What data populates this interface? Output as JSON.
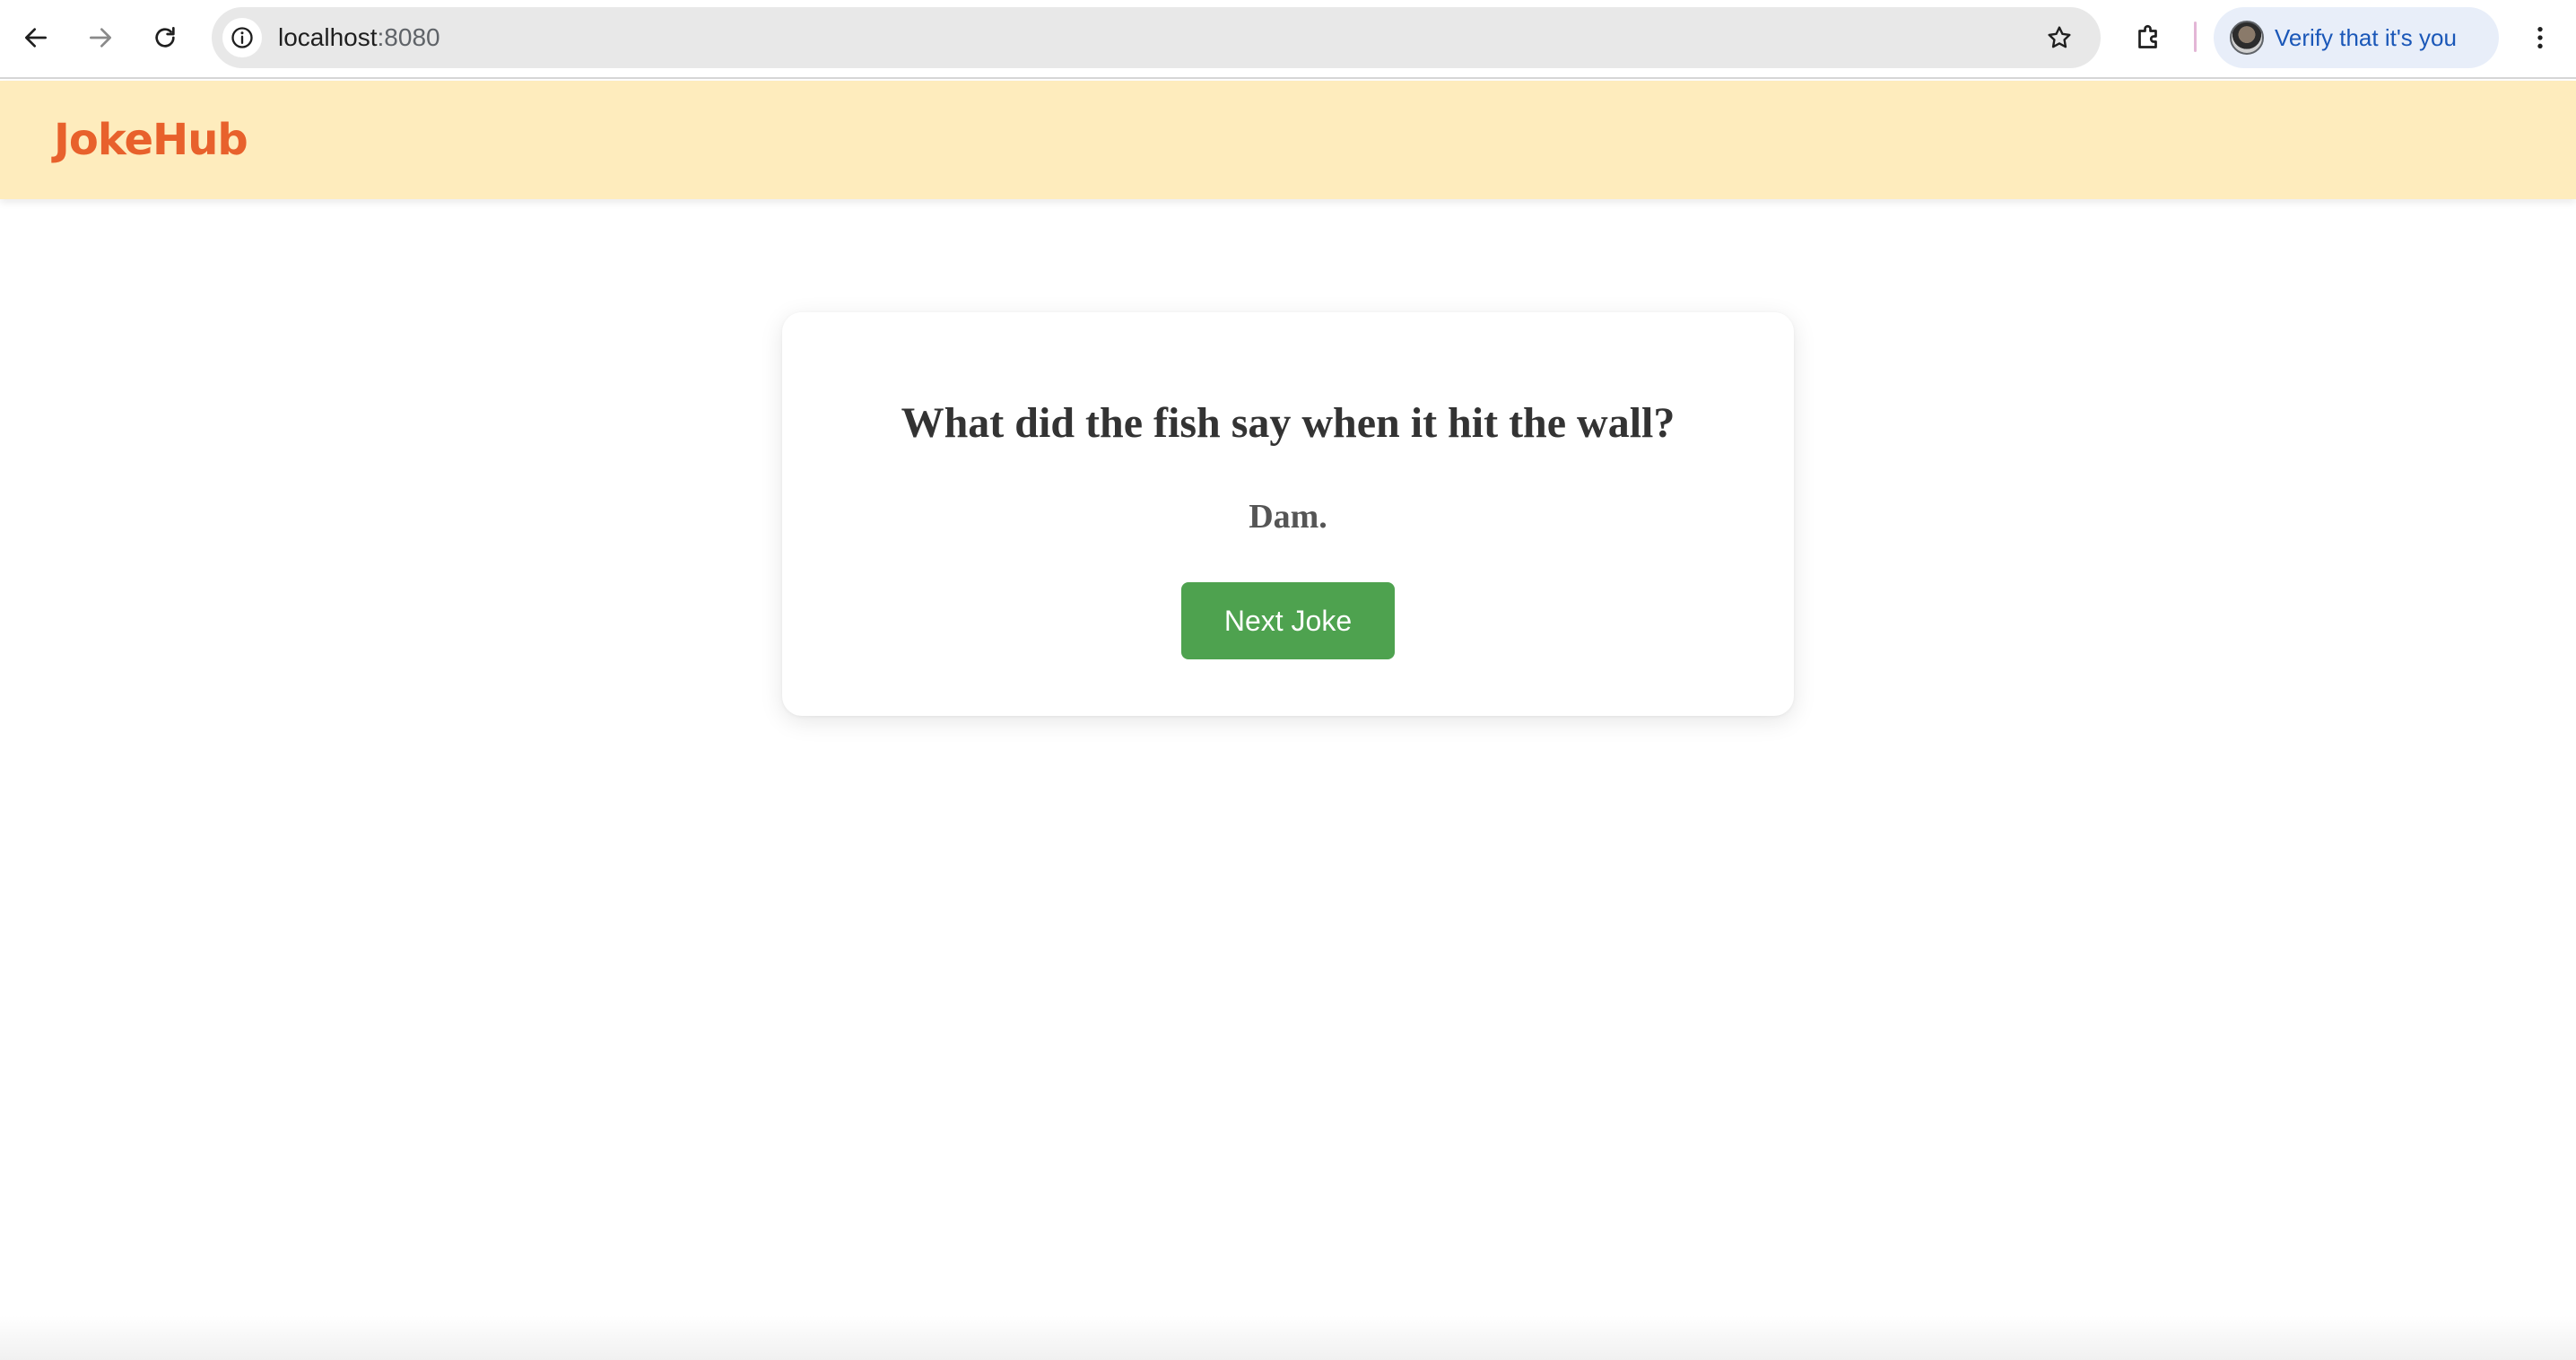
{
  "browser": {
    "url_host": "localhost",
    "url_port": ":8080",
    "verify_label": "Verify that it's you",
    "icons": {
      "back": "arrow-left-icon",
      "forward": "arrow-right-icon",
      "reload": "reload-icon",
      "site_info": "info-icon",
      "bookmark": "star-icon",
      "extensions": "puzzle-icon",
      "profile": "avatar",
      "menu": "kebab-menu-icon"
    }
  },
  "site": {
    "logo": "JokeHub",
    "colors": {
      "header_bg": "#feecbd",
      "logo": "#e8612c",
      "button": "#4ea24f"
    }
  },
  "joke": {
    "setup": "What did the fish say when it hit the wall?",
    "punchline": "Dam.",
    "next_label": "Next Joke"
  }
}
